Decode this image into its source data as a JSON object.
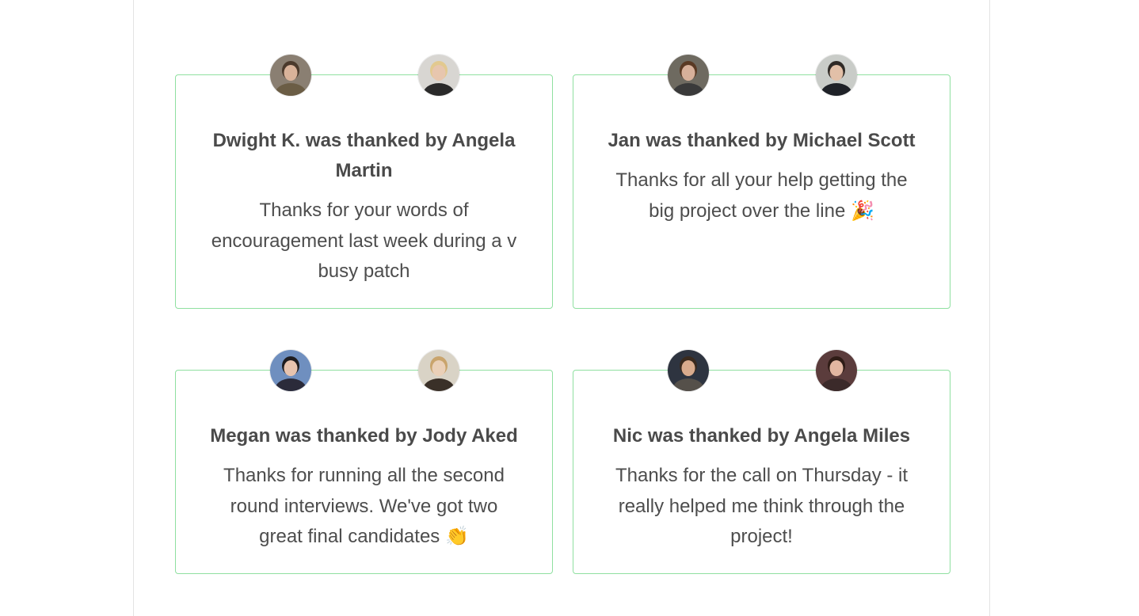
{
  "cards": [
    {
      "title": "Dwight K. was thanked by Angela Martin",
      "message": "Thanks for your words of encouragement last week during a v busy patch",
      "avatars": [
        {
          "name": "dwight-avatar",
          "bg": "#8a7f72",
          "skin": "#d9b39a",
          "hair": "#4b3a2c",
          "shirt": "#6b5d45"
        },
        {
          "name": "angela-avatar",
          "bg": "#d8d6d2",
          "skin": "#e7c6ae",
          "hair": "#e2c98f",
          "shirt": "#2a2a2a"
        }
      ]
    },
    {
      "title": "Jan was thanked by Michael Scott",
      "message": "Thanks for all your help getting the big project over the line 🎉",
      "avatars": [
        {
          "name": "jan-avatar",
          "bg": "#6e6a60",
          "skin": "#d7b09a",
          "hair": "#5a3a24",
          "shirt": "#3a3a3a"
        },
        {
          "name": "michael-avatar",
          "bg": "#c9ccc8",
          "skin": "#e2c0a8",
          "hair": "#2f2a26",
          "shirt": "#1f2228"
        }
      ]
    },
    {
      "title": "Megan was thanked by Jody Aked",
      "message": "Thanks for running all the second round interviews. We've got two great final candidates 👏",
      "avatars": [
        {
          "name": "megan-avatar",
          "bg": "#6f8fbf",
          "skin": "#e7c3ae",
          "hair": "#1e1c1f",
          "shirt": "#2b2b3a"
        },
        {
          "name": "jody-avatar",
          "bg": "#d9d3c6",
          "skin": "#ead0b8",
          "hair": "#c9a46c",
          "shirt": "#3a3028"
        }
      ]
    },
    {
      "title": "Nic was thanked by Angela Miles",
      "message": "Thanks for the call on Thursday - it really helped me think through the project!",
      "avatars": [
        {
          "name": "nic-avatar",
          "bg": "#2e3440",
          "skin": "#d9ab8d",
          "hair": "#3a2a1e",
          "shirt": "#55504a"
        },
        {
          "name": "angela-miles-avatar",
          "bg": "#5b3c3c",
          "skin": "#e2b6a1",
          "hair": "#2f1c16",
          "shirt": "#3b2a2a"
        }
      ]
    }
  ],
  "colors": {
    "card_border": "#8fe0a0",
    "text": "#4a4a4a",
    "page_border": "#e3e3e3"
  }
}
